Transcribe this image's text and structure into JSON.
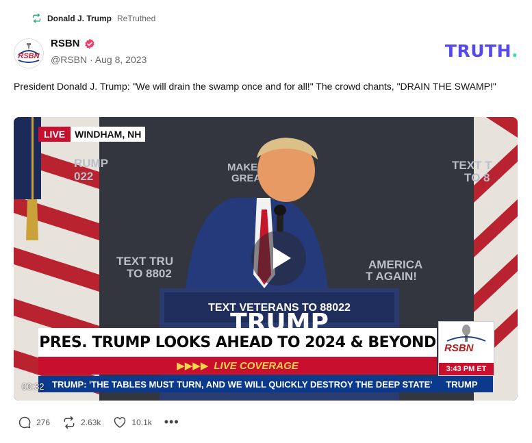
{
  "retruth": {
    "user": "Donald J. Trump",
    "label": "ReTruthed"
  },
  "author": {
    "name": "RSBN",
    "handle": "@RSBN",
    "separator": "·",
    "date": "Aug 8, 2023"
  },
  "brand": {
    "logo_text": "TRUTH.",
    "color": "#5448ee",
    "dot_color": "#2ee6a6"
  },
  "post": {
    "text": "President Donald J. Trump: \"We will drain the swamp once and for all!\" The crowd chants, \"DRAIN THE SWAMP!\""
  },
  "video": {
    "timecode": "00:32",
    "live_label": "LIVE",
    "location": "WINDHAM, NH",
    "headline": "PRES. TRUMP LOOKS AHEAD TO 2024 & BEYOND",
    "subline": "LIVE COVERAGE",
    "ticker": "TRUMP: 'THE TABLES MUST TURN, AND WE WILL QUICKLY DESTROY THE DEEP STATE'",
    "ticker_tail": "TRUMP",
    "bug_name": "RSBN",
    "bug_time": "3:43 PM ET",
    "podium_text": "TEXT VETERANS TO 88022",
    "podium_big": "TRUMP",
    "backdrop_left_1": "RUMP",
    "backdrop_left_2": "022",
    "backdrop_center_1": "MAKE AMERICA",
    "backdrop_center_2": "GREAT AGAIN!",
    "backdrop_right_1": "TEXT T",
    "backdrop_right_2": "TO 8",
    "backdrop_mid_left_1": "TEXT TRU",
    "backdrop_mid_left_2": "TO 8802",
    "backdrop_mid_right_1": "AMERICA",
    "backdrop_mid_right_2": "T AGAIN!"
  },
  "actions": {
    "replies": "276",
    "retruths": "2.63k",
    "likes": "10.1k",
    "more": "•••"
  }
}
